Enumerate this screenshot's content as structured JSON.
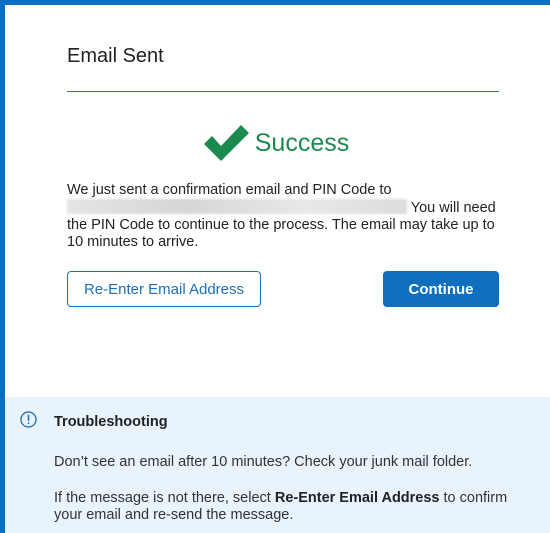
{
  "dialog": {
    "title": "Email Sent",
    "success_label": "Success",
    "message_prefix": "We just sent a confirmation email and PIN Code to",
    "message_suffix": "You will need the PIN Code to continue to the process. The email may take up to 10 minutes to arrive."
  },
  "buttons": {
    "reenter_label": "Re-Enter Email Address",
    "continue_label": "Continue"
  },
  "troubleshooting": {
    "title": "Troubleshooting",
    "text_1": "Don’t see an email after 10 minutes? Check your junk mail folder.",
    "text_2_before": "If the message is not there, select ",
    "text_2_bold": "Re-Enter Email Address",
    "text_2_after": " to confirm your email and re-send the message."
  },
  "colors": {
    "accent": "#0a6fbf",
    "success": "#1b8a4e",
    "panel": "#e9f3fb"
  },
  "icons": {
    "success": "checkmark-icon",
    "troubleshooting": "info-icon"
  }
}
